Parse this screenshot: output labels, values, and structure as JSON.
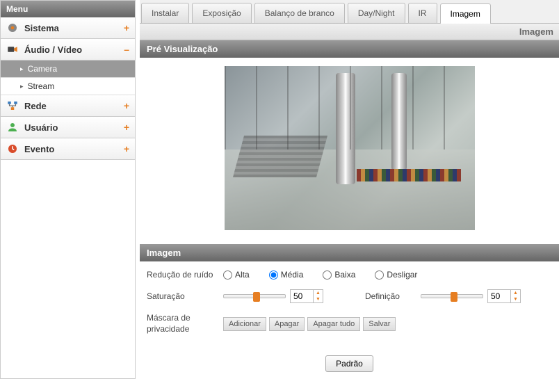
{
  "menu": {
    "header": "Menu",
    "items": [
      {
        "label": "Sistema",
        "toggle": "+"
      },
      {
        "label": "Áudio / Vídeo",
        "toggle": "–"
      },
      {
        "label": "Rede",
        "toggle": "+"
      },
      {
        "label": "Usuário",
        "toggle": "+"
      },
      {
        "label": "Evento",
        "toggle": "+"
      }
    ],
    "submenu": [
      {
        "label": "Camera"
      },
      {
        "label": "Stream"
      }
    ]
  },
  "tabs": [
    {
      "label": "Instalar"
    },
    {
      "label": "Exposição"
    },
    {
      "label": "Balanço de branco"
    },
    {
      "label": "Day/Night"
    },
    {
      "label": "IR"
    },
    {
      "label": "Imagem"
    }
  ],
  "breadcrumb": "Imagem",
  "sections": {
    "preview": "Pré Visualização",
    "image": "Imagem"
  },
  "controls": {
    "noise_label": "Redução de ruído",
    "noise_options": [
      "Alta",
      "Média",
      "Baixa",
      "Desligar"
    ],
    "noise_selected": "Média",
    "saturation_label": "Saturação",
    "saturation_value": "50",
    "sharpness_label": "Definição",
    "sharpness_value": "50",
    "mask_label": "Máscara de privacidade",
    "mask_buttons": [
      "Adicionar",
      "Apagar",
      "Apagar tudo",
      "Salvar"
    ],
    "default_button": "Padrão"
  }
}
